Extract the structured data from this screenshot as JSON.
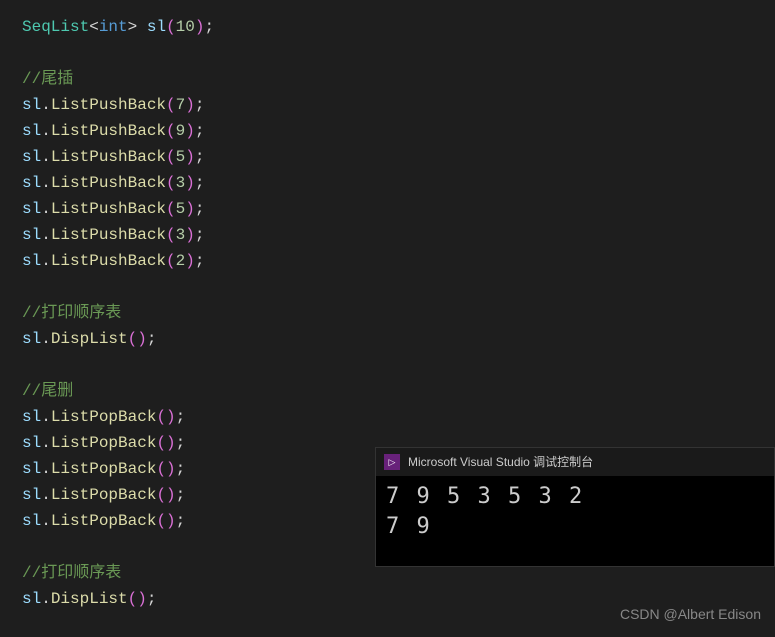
{
  "code": {
    "decl_type": "SeqList",
    "decl_template": "int",
    "decl_var": "sl",
    "decl_arg": "10",
    "comment_tailinsert": "//尾插",
    "push_method": "ListPushBack",
    "push_args": [
      "7",
      "9",
      "5",
      "3",
      "5",
      "3",
      "2"
    ],
    "comment_print1": "//打印顺序表",
    "disp_method": "DispList",
    "comment_taildel": "//尾删",
    "pop_method": "ListPopBack",
    "pop_count": 5,
    "comment_print2": "//打印顺序表"
  },
  "console": {
    "icon_text": "▷",
    "title": "Microsoft Visual Studio 调试控制台",
    "line1": "7 9 5 3 5 3 2",
    "line2": "7 9"
  },
  "watermark": "CSDN @Albert Edison"
}
